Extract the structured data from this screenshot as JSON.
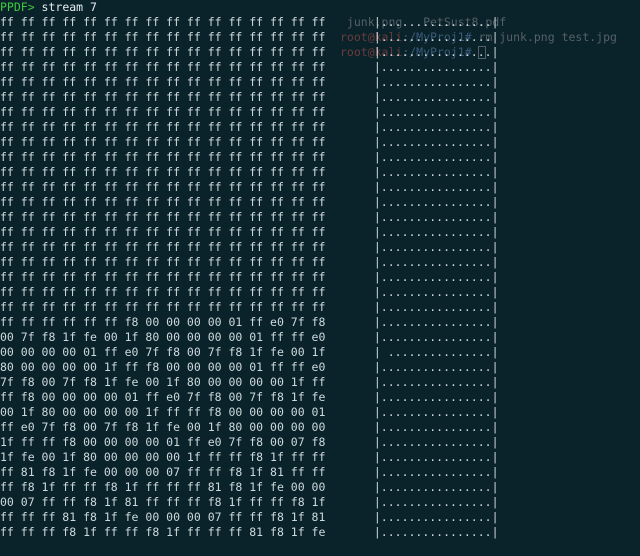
{
  "ghost": {
    "line1_right": " junk.png   PetSust8.pdf",
    "line2_user": "root@kali",
    "line2_path": ":/MyProj1#",
    "line2_cmd": " rm junk.png test.jpg",
    "line3_user": "root@kali",
    "line3_path": ":/MyProj1# "
  },
  "prompt": "PPDF>",
  "command": " stream 7",
  "rows": [
    {
      "hex": "ff ff ff ff ff ff ff ff ff ff ff ff ff ff ff ff",
      "ascii": "|................|"
    },
    {
      "hex": "ff ff ff ff ff ff ff ff ff ff ff ff ff ff ff ff",
      "ascii": "|................|"
    },
    {
      "hex": "ff ff ff ff ff ff ff ff ff ff ff ff ff ff ff ff",
      "ascii": "|................|"
    },
    {
      "hex": "ff ff ff ff ff ff ff ff ff ff ff ff ff ff ff ff",
      "ascii": "|................|"
    },
    {
      "hex": "ff ff ff ff ff ff ff ff ff ff ff ff ff ff ff ff",
      "ascii": "|................|"
    },
    {
      "hex": "ff ff ff ff ff ff ff ff ff ff ff ff ff ff ff ff",
      "ascii": "|................|"
    },
    {
      "hex": "ff ff ff ff ff ff ff ff ff ff ff ff ff ff ff ff",
      "ascii": "|................|"
    },
    {
      "hex": "ff ff ff ff ff ff ff ff ff ff ff ff ff ff ff ff",
      "ascii": "|................|"
    },
    {
      "hex": "ff ff ff ff ff ff ff ff ff ff ff ff ff ff ff ff",
      "ascii": "|................|"
    },
    {
      "hex": "ff ff ff ff ff ff ff ff ff ff ff ff ff ff ff ff",
      "ascii": "|................|"
    },
    {
      "hex": "ff ff ff ff ff ff ff ff ff ff ff ff ff ff ff ff",
      "ascii": "|................|"
    },
    {
      "hex": "ff ff ff ff ff ff ff ff ff ff ff ff ff ff ff ff",
      "ascii": "|................|"
    },
    {
      "hex": "ff ff ff ff ff ff ff ff ff ff ff ff ff ff ff ff",
      "ascii": "|................|"
    },
    {
      "hex": "ff ff ff ff ff ff ff ff ff ff ff ff ff ff ff ff",
      "ascii": "|................|"
    },
    {
      "hex": "ff ff ff ff ff ff ff ff ff ff ff ff ff ff ff ff",
      "ascii": "|................|"
    },
    {
      "hex": "ff ff ff ff ff ff ff ff ff ff ff ff ff ff ff ff",
      "ascii": "|................|"
    },
    {
      "hex": "ff ff ff ff ff ff ff ff ff ff ff ff ff ff ff ff",
      "ascii": "|................|"
    },
    {
      "hex": "ff ff ff ff ff ff ff ff ff ff ff ff ff ff ff ff",
      "ascii": "|................|"
    },
    {
      "hex": "ff ff ff ff ff ff ff ff ff ff ff ff ff ff ff ff",
      "ascii": "|................|"
    },
    {
      "hex": "ff ff ff ff ff ff ff ff ff ff ff ff ff ff ff ff",
      "ascii": "|................|"
    },
    {
      "hex": "ff ff ff ff ff ff f8 00 00 00 00 01 ff e0 7f f8",
      "ascii": "|................|"
    },
    {
      "hex": "00 7f f8 1f fe 00 1f 80 00 00 00 00 01 ff ff e0",
      "ascii": "|................|"
    },
    {
      "hex": "00 00 00 00 01 ff e0 7f f8 00 7f f8 1f fe 00 1f",
      "ascii": "| ...............|"
    },
    {
      "hex": "80 00 00 00 00 1f ff f8 00 00 00 00 01 ff ff e0",
      "ascii": "|................|"
    },
    {
      "hex": "7f f8 00 7f f8 1f fe 00 1f 80 00 00 00 00 1f ff",
      "ascii": "|................|"
    },
    {
      "hex": "ff f8 00 00 00 00 01 ff e0 7f f8 00 7f f8 1f fe",
      "ascii": "|................|"
    },
    {
      "hex": "00 1f 80 00 00 00 00 1f ff ff f8 00 00 00 00 01",
      "ascii": "|................|"
    },
    {
      "hex": "ff e0 7f f8 00 7f f8 1f fe 00 1f 80 00 00 00 00",
      "ascii": "|................|"
    },
    {
      "hex": "1f ff ff f8 00 00 00 00 01 ff e0 7f f8 00 07 f8",
      "ascii": "|................|"
    },
    {
      "hex": "1f fe 00 1f 80 00 00 00 00 1f ff ff f8 1f ff ff",
      "ascii": "|................|"
    },
    {
      "hex": "ff 81 f8 1f fe 00 00 00 07 ff ff f8 1f 81 ff ff",
      "ascii": "|................|"
    },
    {
      "hex": "ff f8 1f ff ff f8 1f ff ff ff 81 f8 1f fe 00 00",
      "ascii": "|................|"
    },
    {
      "hex": "00 07 ff ff f8 1f 81 ff ff ff f8 1f ff ff f8 1f",
      "ascii": "|................|"
    },
    {
      "hex": "ff ff ff 81 f8 1f fe 00 00 00 07 ff ff f8 1f 81",
      "ascii": "|................|"
    },
    {
      "hex": "ff ff ff f8 1f ff ff f8 1f ff ff ff 81 f8 1f fe",
      "ascii": "|................|"
    }
  ]
}
